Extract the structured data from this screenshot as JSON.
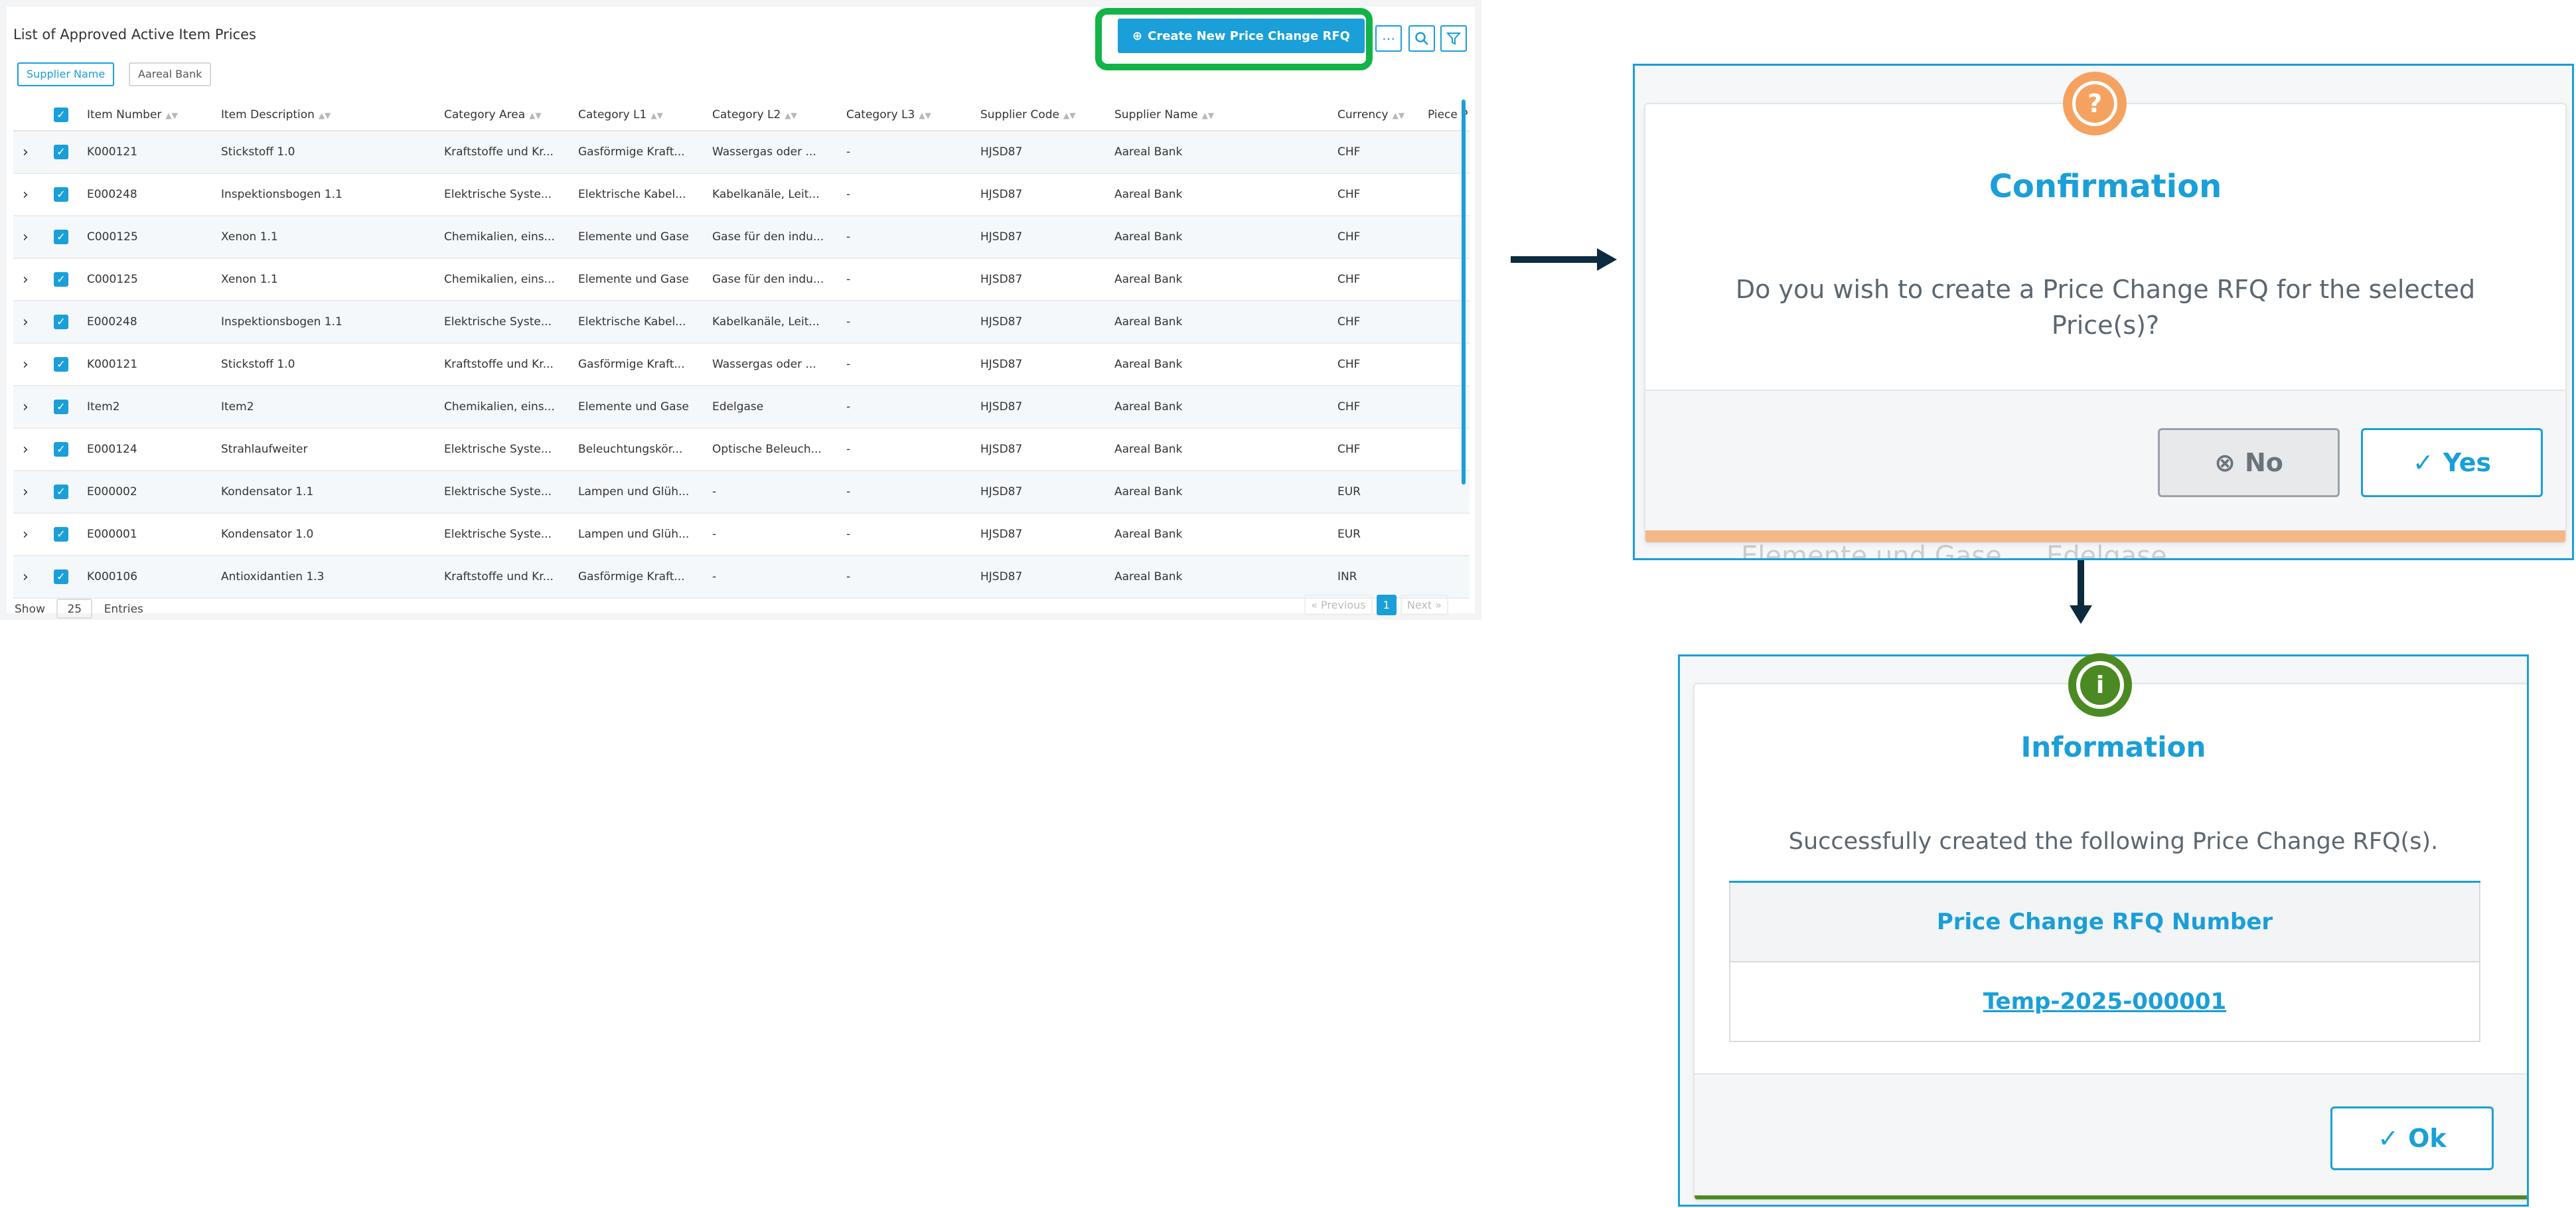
{
  "list": {
    "title": "List of Approved Active Item Prices",
    "filter_chips": [
      "Supplier Name",
      "Aareal Bank"
    ],
    "create_button_label": "Create New Price Change RFQ",
    "columns": [
      "Item Number",
      "Item Description",
      "Category Area",
      "Category L1",
      "Category L2",
      "Category L3",
      "Supplier Code",
      "Supplier Name",
      "Currency",
      "Piece P"
    ],
    "rows": [
      [
        "K000121",
        "Stickstoff 1.0",
        "Kraftstoffe und Kr...",
        "Gasförmige Kraft...",
        "Wassergas oder ...",
        "-",
        "HJSD87",
        "Aareal Bank",
        "CHF",
        ""
      ],
      [
        "E000248",
        "Inspektionsbogen 1.1",
        "Elektrische Syste...",
        "Elektrische Kabel...",
        "Kabelkanäle, Leit...",
        "-",
        "HJSD87",
        "Aareal Bank",
        "CHF",
        ""
      ],
      [
        "C000125",
        "Xenon 1.1",
        "Chemikalien, eins...",
        "Elemente und Gase",
        "Gase für den indu...",
        "-",
        "HJSD87",
        "Aareal Bank",
        "CHF",
        ""
      ],
      [
        "C000125",
        "Xenon 1.1",
        "Chemikalien, eins...",
        "Elemente und Gase",
        "Gase für den indu...",
        "-",
        "HJSD87",
        "Aareal Bank",
        "CHF",
        ""
      ],
      [
        "E000248",
        "Inspektionsbogen 1.1",
        "Elektrische Syste...",
        "Elektrische Kabel...",
        "Kabelkanäle, Leit...",
        "-",
        "HJSD87",
        "Aareal Bank",
        "CHF",
        ""
      ],
      [
        "K000121",
        "Stickstoff 1.0",
        "Kraftstoffe und Kr...",
        "Gasförmige Kraft...",
        "Wassergas oder ...",
        "-",
        "HJSD87",
        "Aareal Bank",
        "CHF",
        ""
      ],
      [
        "Item2",
        "Item2",
        "Chemikalien, eins...",
        "Elemente und Gase",
        "Edelgase",
        "-",
        "HJSD87",
        "Aareal Bank",
        "CHF",
        ""
      ],
      [
        "E000124",
        "Strahlaufweiter",
        "Elektrische Syste...",
        "Beleuchtungskör...",
        "Optische Beleuch...",
        "-",
        "HJSD87",
        "Aareal Bank",
        "CHF",
        ""
      ],
      [
        "E000002",
        "Kondensator 1.1",
        "Elektrische Syste...",
        "Lampen und Glüh...",
        "-",
        "-",
        "HJSD87",
        "Aareal Bank",
        "EUR",
        ""
      ],
      [
        "E000001",
        "Kondensator 1.0",
        "Elektrische Syste...",
        "Lampen und Glüh...",
        "-",
        "-",
        "HJSD87",
        "Aareal Bank",
        "EUR",
        ""
      ],
      [
        "K000106",
        "Antioxidantien 1.3",
        "Kraftstoffe und Kr...",
        "Gasförmige Kraft...",
        "-",
        "-",
        "HJSD87",
        "Aareal Bank",
        "INR",
        ""
      ]
    ],
    "footer": {
      "show_label": "Show",
      "entries_value": "25",
      "entries_label": "Entries",
      "prev_label": "« Previous",
      "current_page": "1",
      "next_label": "Next »"
    }
  },
  "confirm_dialog": {
    "title": "Confirmation",
    "message": "Do you wish to create a Price Change RFQ for the selected Price(s)?",
    "no_label": "No",
    "yes_label": "Yes",
    "background_text": [
      "Elemente und Gase",
      "Edelgase"
    ]
  },
  "info_dialog": {
    "title": "Information",
    "message": "Successfully created the following Price Change RFQ(s).",
    "table_header": "Price Change RFQ Number",
    "rfq_number": "Temp-2025-000001",
    "ok_label": "Ok"
  },
  "colors": {
    "accent": "#1a9fd8",
    "highlight": "#12b347",
    "confirm_icon": "#f5a261",
    "info_icon": "#4b8a23"
  }
}
